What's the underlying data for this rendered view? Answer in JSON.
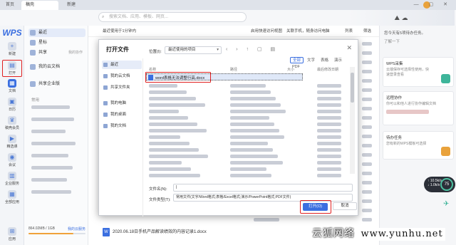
{
  "tabs": {
    "home": "首页",
    "doc": "稿壳",
    "new": "新建"
  },
  "search": {
    "placeholder": "搜索文档、应用、模板、网页..."
  },
  "rail": {
    "items": [
      {
        "label": "新建"
      },
      {
        "label": "打开"
      },
      {
        "label": "文档"
      },
      {
        "label": "日历"
      },
      {
        "label": "稿壳会员"
      },
      {
        "label": "精选课"
      },
      {
        "label": "会议"
      },
      {
        "label": "企业服务"
      },
      {
        "label": "全部应用"
      },
      {
        "label": "应用"
      }
    ]
  },
  "leftpanel": {
    "items": [
      {
        "label": "最近"
      },
      {
        "label": "星标"
      },
      {
        "label": "共享",
        "sub": "我的协作"
      },
      {
        "label": "我的云文档"
      },
      {
        "label": "共享企业版"
      }
    ],
    "section": "常用",
    "storage": {
      "text": "864.02MB / 1GB",
      "upgrade": "我的云服务"
    }
  },
  "toolbar": {
    "recent": "最近使用于1分钟内",
    "t2": "启用快速访问视图",
    "t3": "关联手机，随身访问电脑",
    "t4": "列表",
    "t5": "筛选"
  },
  "main": {
    "last_file": "2020.06.18日手机产品解读绩效的内容记录1.docx"
  },
  "rightpanel": {
    "head": "您今天有5项待办任务。",
    "head2": "了解一下",
    "card1": {
      "title": "WPS采集",
      "desc": "云端保存可选择性使用，快速登录查看"
    },
    "card2": {
      "title": "远程协作",
      "desc": "你可以和他人进行协作编辑文档"
    },
    "card3": {
      "title": "待办任务",
      "desc": "您有新的WPS模板可选择"
    },
    "speed": {
      "up": "↑ 10.5k/s",
      "down": "↓ 1.0k/s",
      "pct": "75"
    }
  },
  "dialog": {
    "title": "打开文件",
    "sidebar": [
      "最近",
      "我的云文档",
      "共享文件夹",
      "我的电脑",
      "我的桌面",
      "我的文档"
    ],
    "location_label": "位置(I):",
    "location_value": "最近使用的项目",
    "filters": [
      "全部",
      "文字",
      "表格",
      "演示",
      "PDF"
    ],
    "columns": [
      "名称",
      "路径",
      "大小",
      "最后修改日期"
    ],
    "selected_file": "word表格无法调整行高.docx",
    "filename_label": "文件名(N):",
    "filename_value": "|",
    "filetype_label": "文件类型(T):",
    "filetype_value": "常用文件(文字/Word格式;表格/Excel格式;演示/PowerPoint格式;PDF文件)",
    "open": "打开(O)",
    "cancel": "取消"
  },
  "watermark": {
    "text": "云狐网络",
    "url": "www.yunhu.net"
  }
}
